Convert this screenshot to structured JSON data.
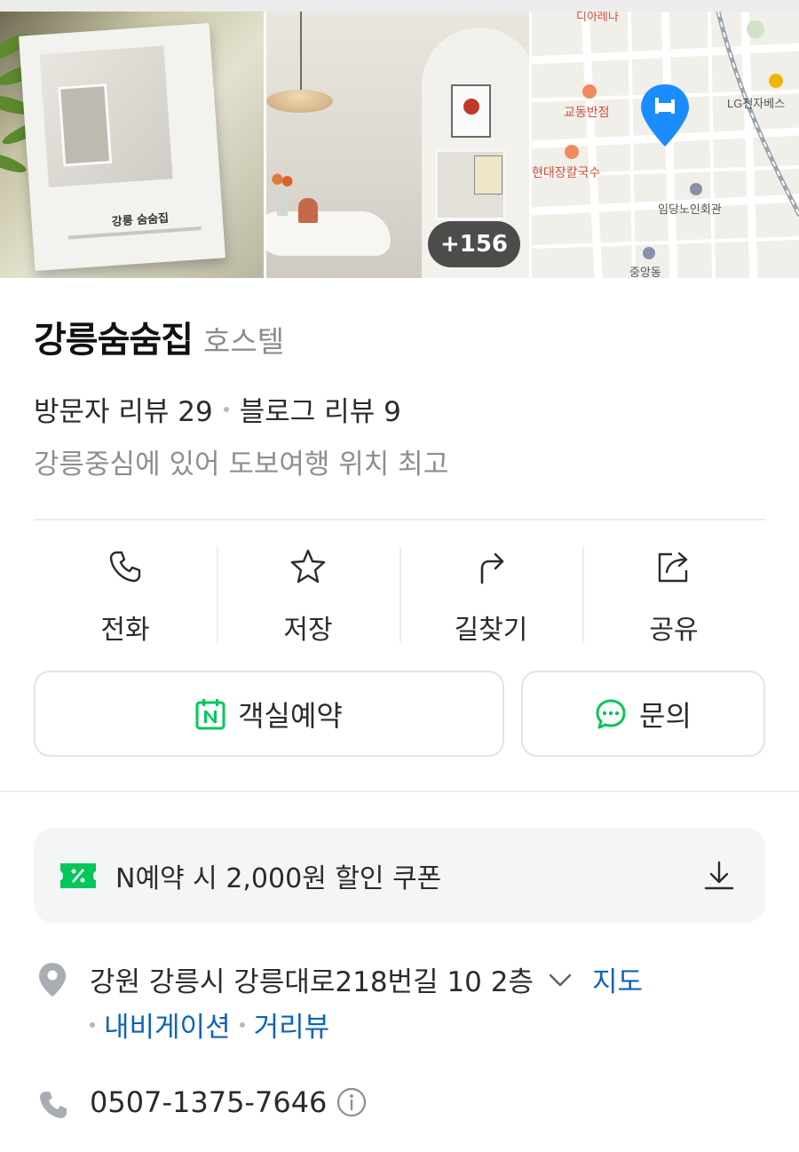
{
  "gallery": {
    "photo_count_badge": "+156",
    "book_title": "강릉 숨숨집",
    "map_labels": [
      "디아레나",
      "교동반점",
      "LG전자베스",
      "현대장칼국수",
      "임당노인회관",
      "중앙동"
    ]
  },
  "place": {
    "name": "강릉숨숨집",
    "category": "호스텔",
    "visitor_reviews": "방문자 리뷰 29",
    "blog_reviews": "블로그 리뷰 9",
    "description": "강릉중심에 있어 도보여행 위치 최고"
  },
  "actions": [
    {
      "label": "전화",
      "icon": "phone-icon"
    },
    {
      "label": "저장",
      "icon": "star-icon"
    },
    {
      "label": "길찾기",
      "icon": "directions-icon"
    },
    {
      "label": "공유",
      "icon": "share-icon"
    }
  ],
  "buttons": {
    "reserve_label": "객실예약",
    "inquiry_label": "문의"
  },
  "coupon": {
    "text": "N예약 시 2,000원 할인 쿠폰"
  },
  "address": {
    "text": "강원 강릉시 강릉대로218번길 10 2층",
    "map_link": "지도",
    "navigation_link": "내비게이션",
    "street_view_link": "거리뷰"
  },
  "phone": {
    "number": "0507-1375-7646"
  },
  "colors": {
    "naver_green": "#03c75a",
    "link_blue": "#0e63b8",
    "map_pin_blue": "#1a8cff"
  }
}
